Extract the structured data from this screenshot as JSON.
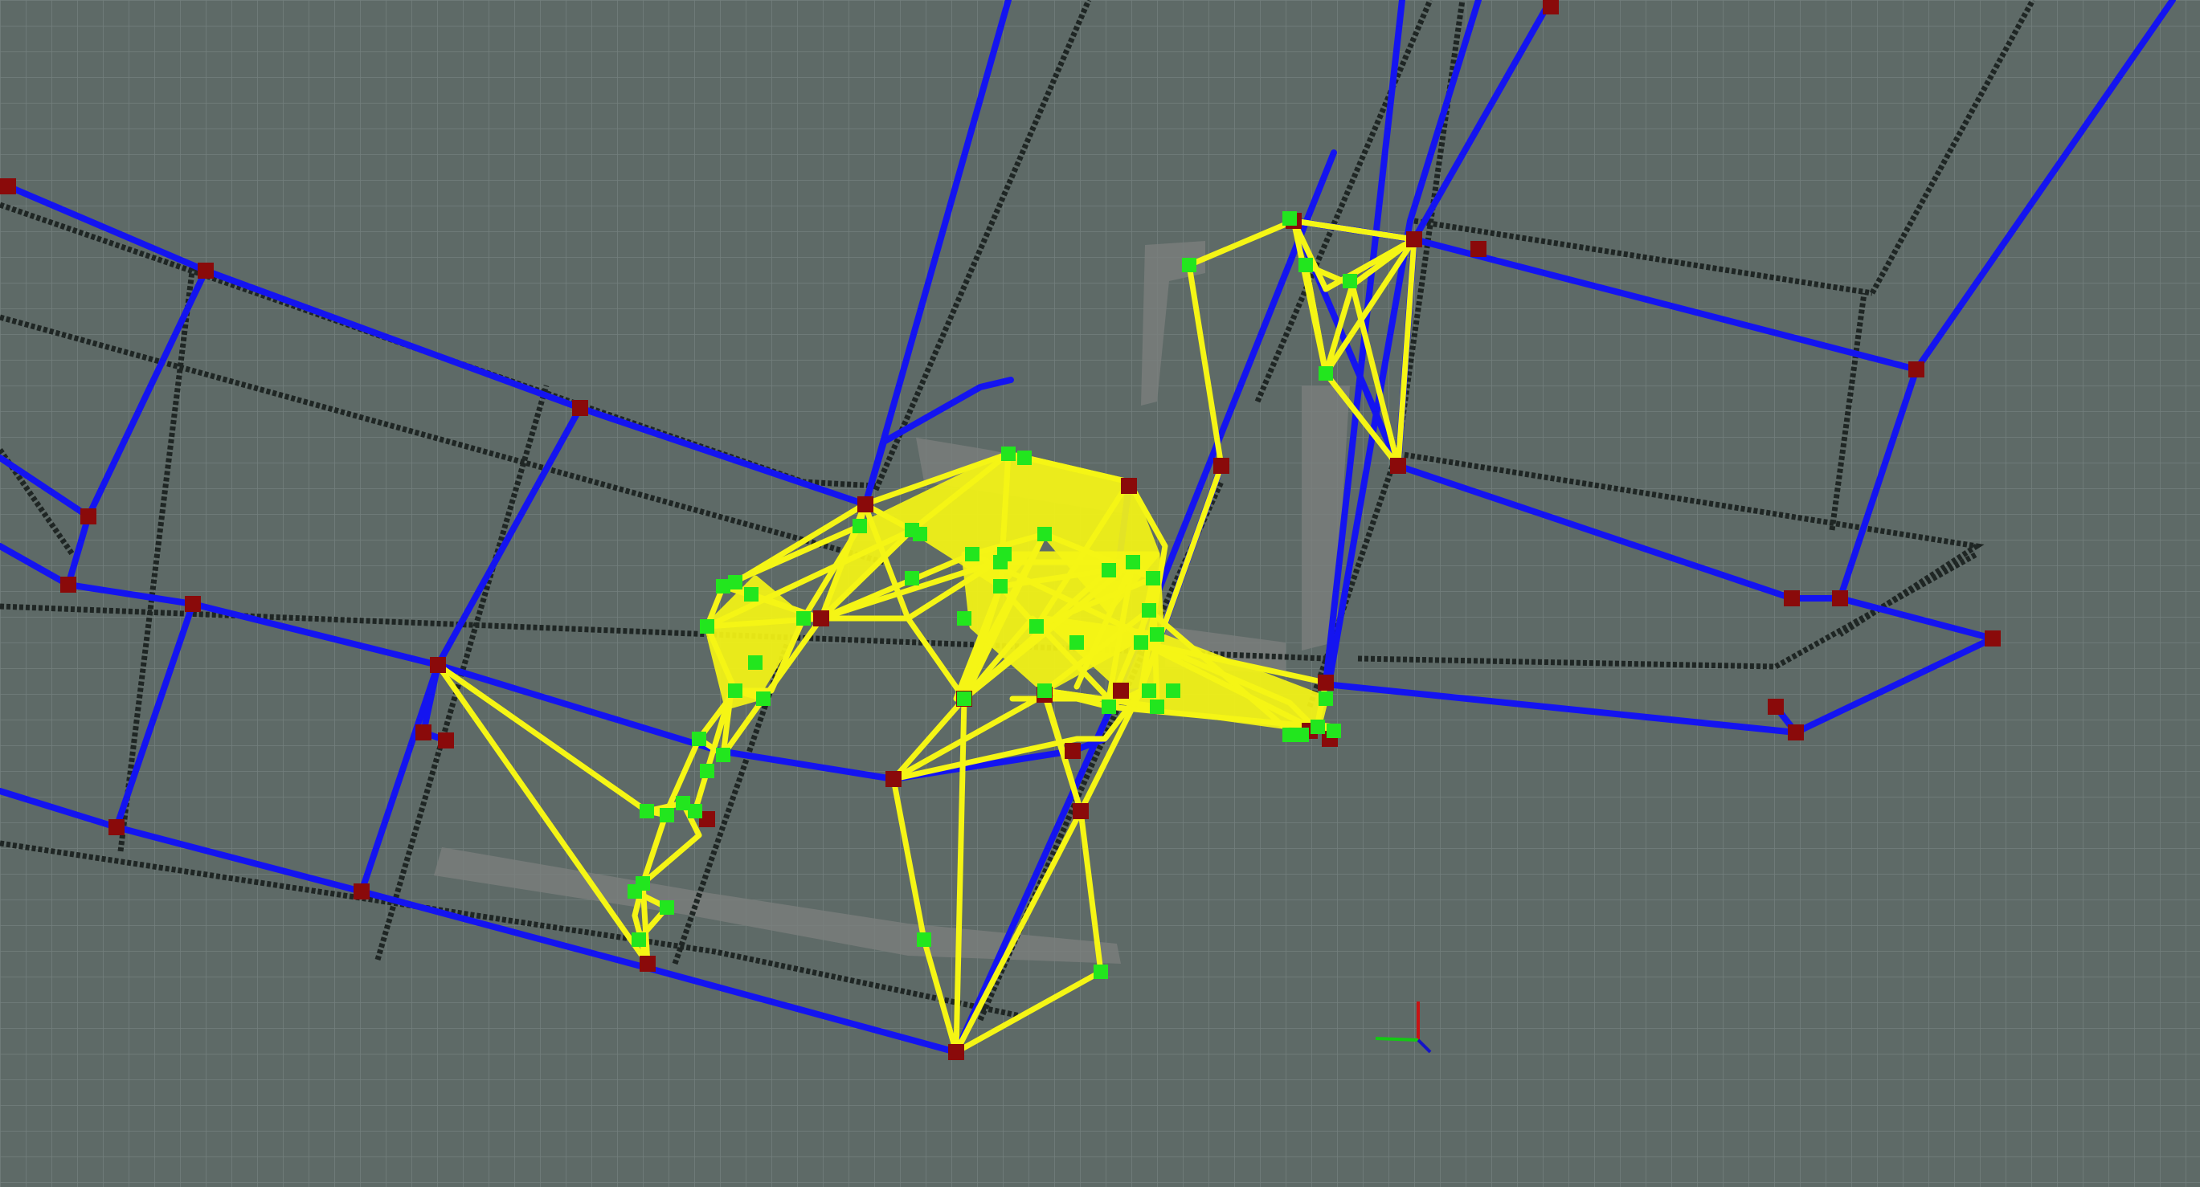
{
  "scene": {
    "background_color": "#5e6a67",
    "grid_color": "#74807d",
    "wall_color": "#1f2624",
    "shadow_color": "#7a7d7c",
    "blue_edge_color": "#1414f0",
    "yellow_edge_color": "#f5f515",
    "red_node_color": "#8a0a0a",
    "green_node_color": "#22e61e",
    "axis_colors": {
      "x": "#c81414",
      "y": "#14c814",
      "z": "#1414c8"
    }
  },
  "icons": {
    "red_node": "pose-node-icon",
    "green_node": "landmark-node-icon",
    "axes": "origin-axes-icon"
  }
}
